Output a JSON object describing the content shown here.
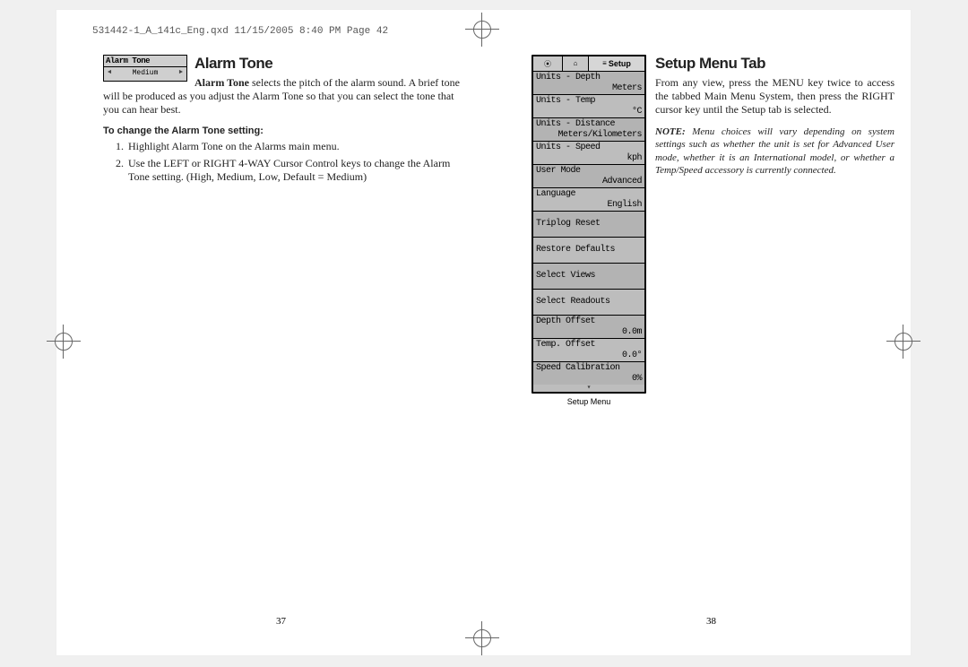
{
  "header_line": "531442-1_A_141c_Eng.qxd  11/15/2005  8:40 PM  Page 42",
  "left_page": {
    "heading": "Alarm Tone",
    "device": {
      "title": "Alarm Tone",
      "value": "Medium"
    },
    "intro_bold": "Alarm Tone",
    "intro_rest": " selects the pitch of the alarm sound. A brief tone will be produced as you adjust the Alarm Tone so that you can select the tone that you can hear best.",
    "subhead": "To change the Alarm Tone setting:",
    "steps": [
      "Highlight Alarm Tone on the Alarms main menu.",
      "Use the LEFT or RIGHT 4-WAY Cursor Control keys to change the Alarm Tone setting. (High, Medium, Low, Default = Medium)"
    ],
    "pagenum": "37"
  },
  "right_page": {
    "heading": "Setup Menu Tab",
    "device_caption": "Setup Menu",
    "tabs": {
      "t1_icon": "⦿",
      "t2_icon": "⌂",
      "t3_label": "Setup",
      "t3_prefix": "≡"
    },
    "rows": [
      {
        "label": "Units - Depth",
        "value": "Meters"
      },
      {
        "label": "Units - Temp",
        "value": "°C"
      },
      {
        "label": "Units - Distance",
        "value": "Meters/Kilometers"
      },
      {
        "label": "Units - Speed",
        "value": "kph"
      },
      {
        "label": "User Mode",
        "value": "Advanced"
      },
      {
        "label": "Language",
        "value": "English"
      },
      {
        "label": "Triplog Reset",
        "value": ""
      },
      {
        "label": "Restore Defaults",
        "value": ""
      },
      {
        "label": "Select Views",
        "value": ""
      },
      {
        "label": "Select Readouts",
        "value": ""
      },
      {
        "label": "Depth Offset",
        "value": "0.0m"
      },
      {
        "label": "Temp. Offset",
        "value": "0.0°"
      },
      {
        "label": "Speed Calibration",
        "value": "0%"
      }
    ],
    "intro": "From any view, press the MENU key twice to access the tabbed Main Menu System, then press the RIGHT cursor key until the Setup tab is selected.",
    "note_bold": "NOTE:",
    "note_rest": " Menu choices will vary depending on system settings such as whether the unit is set for Advanced User mode, whether it is an International model, or whether a Temp/Speed accessory is currently connected.",
    "pagenum": "38"
  }
}
